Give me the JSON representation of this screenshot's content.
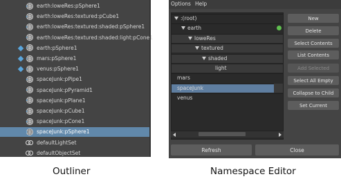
{
  "outliner": {
    "caption": "Outliner",
    "items": [
      {
        "label": "earth:loweRes:pSphere1",
        "icon": "mesh-icon"
      },
      {
        "label": "earth:loweRes:textured:pCube1",
        "icon": "mesh-icon"
      },
      {
        "label": "earth:loweRes:textured:shaded:pSphere1",
        "icon": "mesh-icon"
      },
      {
        "label": "earth:loweRes:textured:shaded:light:pCone1",
        "icon": "mesh-icon"
      },
      {
        "label": "earth:pSphere1",
        "icon": "mesh-icon",
        "diamond": true
      },
      {
        "label": "mars:pSphere1",
        "icon": "mesh-icon",
        "diamond": true
      },
      {
        "label": "venus:pSphere1",
        "icon": "mesh-icon",
        "diamond": true
      },
      {
        "label": "spaceJunk:pPipe1",
        "icon": "mesh-icon"
      },
      {
        "label": "spaceJunk:pPyramid1",
        "icon": "mesh-icon"
      },
      {
        "label": "spaceJunk:pPlane1",
        "icon": "mesh-icon"
      },
      {
        "label": "spaceJunk:pCube1",
        "icon": "mesh-icon"
      },
      {
        "label": "spaceJunk:pCone1",
        "icon": "mesh-icon"
      },
      {
        "label": "spaceJunk:pSphere1",
        "icon": "mesh-icon",
        "selected": true
      },
      {
        "label": "defaultLightSet",
        "icon": "set-icon"
      },
      {
        "label": "defaultObjectSet",
        "icon": "set-icon"
      }
    ]
  },
  "namespace_editor": {
    "caption": "Namespace Editor",
    "menu": [
      "Options",
      "Help"
    ],
    "tree": [
      {
        "label": ":(root)",
        "depth": 0,
        "expanded": true
      },
      {
        "label": "earth",
        "depth": 1,
        "expanded": true,
        "current": true
      },
      {
        "label": "loweRes",
        "depth": 2,
        "expanded": true
      },
      {
        "label": "textured",
        "depth": 3,
        "expanded": true
      },
      {
        "label": "shaded",
        "depth": 4,
        "expanded": true
      },
      {
        "label": "light",
        "depth": 5
      },
      {
        "label": "mars",
        "depth": 1
      },
      {
        "label": "spaceJunk",
        "depth": 1,
        "selected": true
      },
      {
        "label": "venus",
        "depth": 1
      }
    ],
    "buttons": [
      {
        "label": "New"
      },
      {
        "label": "Delete"
      },
      {
        "label": "Select Contents"
      },
      {
        "label": "List Contents"
      },
      {
        "label": "Add Selected",
        "disabled": true
      },
      {
        "label": "Select All Empty"
      },
      {
        "label": "Collapse to Child"
      },
      {
        "label": "Set Current"
      }
    ],
    "refresh_label": "Refresh",
    "close_label": "Close"
  },
  "colors": {
    "panel_bg": "#444444",
    "selection": "#6188aa",
    "current_indicator": "#5fbf4f"
  }
}
